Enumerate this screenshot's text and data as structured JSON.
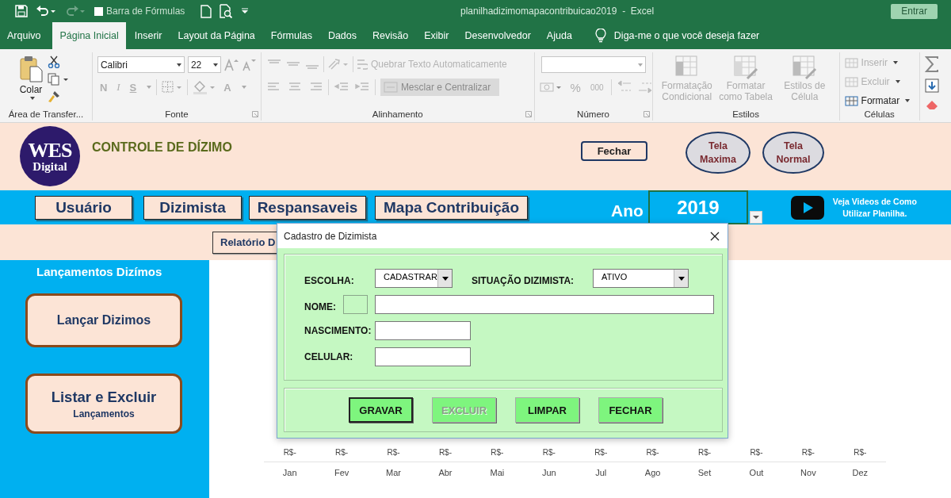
{
  "quick_access": {
    "formula_bar": {
      "label": "Barra de Fórmulas",
      "checked": false
    },
    "redo_disabled": true
  },
  "window": {
    "title": "planilhadizimomapacontribuicao2019  -  Excel",
    "sign_in": "Entrar"
  },
  "tabs": [
    {
      "label": "Arquivo",
      "selected": false
    },
    {
      "label": "Página Inicial",
      "selected": true
    },
    {
      "label": "Inserir",
      "selected": false
    },
    {
      "label": "Layout da Página",
      "selected": false
    },
    {
      "label": "Fórmulas",
      "selected": false
    },
    {
      "label": "Dados",
      "selected": false
    },
    {
      "label": "Revisão",
      "selected": false
    },
    {
      "label": "Exibir",
      "selected": false
    },
    {
      "label": "Desenvolvedor",
      "selected": false
    },
    {
      "label": "Ajuda",
      "selected": false
    }
  ],
  "tell_me": "Diga-me o que você deseja fazer",
  "ribbon": {
    "clipboard": {
      "paste": "Colar",
      "label": "Área de Transfer..."
    },
    "font": {
      "name": "Calibri",
      "size": "22",
      "format_buttons": [
        {
          "label": "N",
          "disabled": true
        },
        {
          "label": "I",
          "disabled": true
        },
        {
          "label": "S",
          "disabled": true
        }
      ],
      "color_button": {
        "label": "A",
        "disabled": true
      },
      "label": "Fonte"
    },
    "alignment": {
      "wrap": {
        "label": "Quebrar Texto Automaticamente",
        "disabled": true
      },
      "merge": {
        "label": "Mesclar e Centralizar",
        "disabled": true
      },
      "label": "Alinhamento"
    },
    "number": {
      "buttons": [
        {
          "label": "%",
          "disabled": true
        },
        {
          "label": "000",
          "disabled": true
        }
      ],
      "label": "Número"
    },
    "styles": {
      "items": [
        {
          "label": "Formatação Condicional",
          "disabled": true
        },
        {
          "label": "Formatar como Tabela",
          "disabled": true
        },
        {
          "label": "Estilos de Célula",
          "disabled": true
        }
      ],
      "label": "Estilos"
    },
    "cells": {
      "items": [
        {
          "label": "Inserir",
          "disabled": true
        },
        {
          "label": "Excluir",
          "disabled": true
        },
        {
          "label": "Formatar",
          "disabled": false
        }
      ],
      "label": "Células"
    }
  },
  "sheet": {
    "logo": [
      "WES",
      "Digital"
    ],
    "title": "CONTROLE DE DÍZIMO",
    "close_button": "Fechar",
    "view_buttons": [
      "Tela Maxima",
      "Tela Normal"
    ],
    "nav_buttons": [
      "Usuário",
      "Dizimista",
      "Respansaveis",
      "Mapa Contribuição"
    ],
    "year_label": "Ano",
    "year": "2019",
    "video_link": "Veja Videos de Como Utilizar Planilha.",
    "report_button": "Relatório D",
    "sidebar": {
      "title": "Lançamentos Dizímos",
      "buttons": [
        {
          "label": "Lançar Dizimos"
        },
        {
          "label": "Listar e Excluir",
          "sublabel": "Lançamentos"
        }
      ]
    },
    "monthly": [
      {
        "value": "R$-",
        "month": "Jan"
      },
      {
        "value": "R$-",
        "month": "Fev"
      },
      {
        "value": "R$-",
        "month": "Mar"
      },
      {
        "value": "R$-",
        "month": "Abr"
      },
      {
        "value": "R$-",
        "month": "Mai"
      },
      {
        "value": "R$-",
        "month": "Jun"
      },
      {
        "value": "R$-",
        "month": "Jul"
      },
      {
        "value": "R$-",
        "month": "Ago"
      },
      {
        "value": "R$-",
        "month": "Set"
      },
      {
        "value": "R$-",
        "month": "Out"
      },
      {
        "value": "R$-",
        "month": "Nov"
      },
      {
        "value": "R$-",
        "month": "Dez"
      }
    ]
  },
  "dialog": {
    "title": "Cadastro de Dizimista",
    "choice": {
      "label": "ESCOLHA:",
      "value": "CADASTRAR"
    },
    "status": {
      "label": "SITUAÇÃO DIZIMISTA:",
      "value": "ATIVO"
    },
    "name_label": "NOME:",
    "birth_label": "NASCIMENTO:",
    "phone_label": "CELULAR:",
    "buttons": [
      {
        "label": "GRAVAR",
        "default": true,
        "disabled": false
      },
      {
        "label": "EXCLUIR",
        "default": false,
        "disabled": true
      },
      {
        "label": "LIMPAR",
        "default": false,
        "disabled": false
      },
      {
        "label": "FECHAR",
        "default": false,
        "disabled": false
      }
    ]
  }
}
